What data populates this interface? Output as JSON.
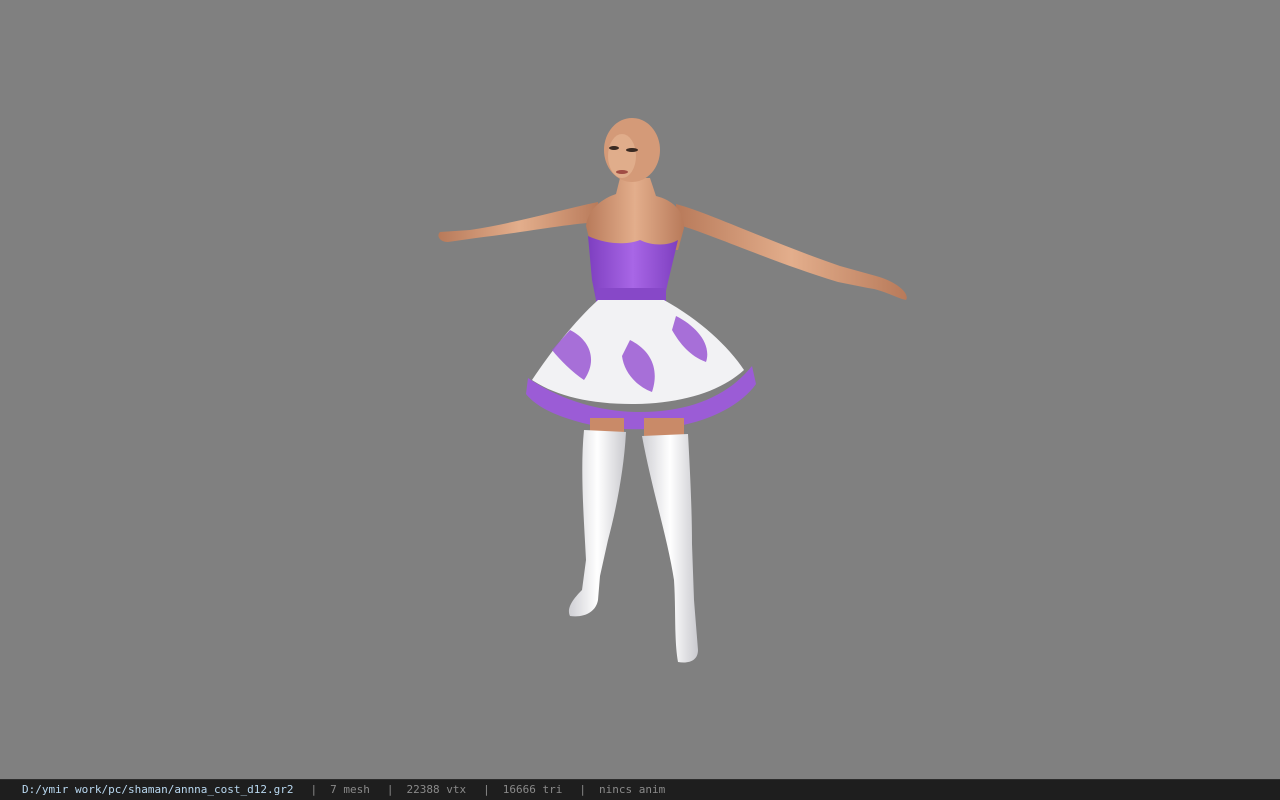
{
  "viewport": {
    "background_color": "#808080",
    "model": {
      "skin_color": "#d9a07e",
      "dress_color": "#9b5cd6",
      "skirt_print_color": "#f2f2f4",
      "boots_color": "#f4f4f4"
    }
  },
  "statusbar": {
    "file_path": "D:/ymir work/pc/shaman/annna_cost_d12.gr2",
    "separator": "|",
    "mesh": "7 mesh",
    "vertices": "22388 vtx",
    "triangles": "16666 tri",
    "animation": "nincs anim",
    "path_color": "#b9d8f0",
    "text_color": "#8a8a8a"
  }
}
